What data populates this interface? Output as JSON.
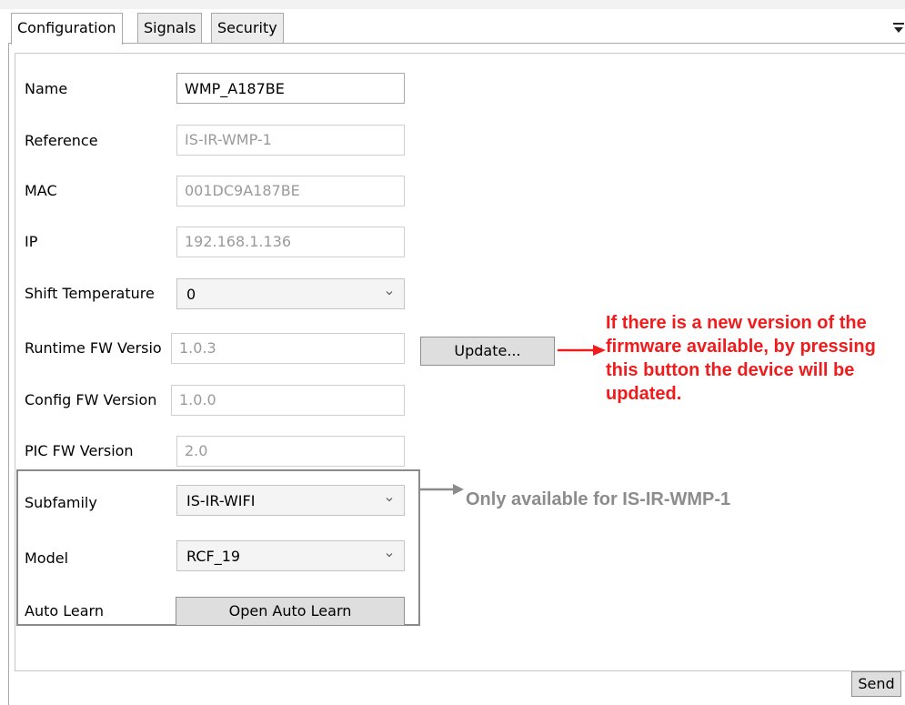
{
  "tabs": [
    {
      "label": "Configuration",
      "active": true
    },
    {
      "label": "Signals",
      "active": false
    },
    {
      "label": "Security",
      "active": false
    }
  ],
  "form": {
    "name": {
      "label": "Name",
      "value": "WMP_A187BE"
    },
    "reference": {
      "label": "Reference",
      "value": "IS-IR-WMP-1"
    },
    "mac": {
      "label": "MAC",
      "value": "001DC9A187BE"
    },
    "ip": {
      "label": "IP",
      "value": "192.168.1.136"
    },
    "shift_temperature": {
      "label": "Shift Temperature",
      "value": "0"
    },
    "runtime_fw": {
      "label": "Runtime FW Versio",
      "value": "1.0.3"
    },
    "config_fw": {
      "label": "Config FW Version",
      "value": "1.0.0"
    },
    "pic_fw": {
      "label": "PIC FW Version",
      "value": "2.0"
    },
    "subfamily": {
      "label": "Subfamily",
      "value": "IS-IR-WIFI"
    },
    "model": {
      "label": "Model",
      "value": "RCF_19"
    },
    "auto_learn": {
      "label": "Auto Learn",
      "button": "Open Auto Learn"
    }
  },
  "buttons": {
    "update": "Update...",
    "send": "Send"
  },
  "annotations": {
    "update_note": "If there is a new version of the firmware available, by pressing this button the device will be updated.",
    "group_note": "Only available for IS-IR-WMP-1"
  },
  "colors": {
    "annotation_red": "#ee1c1c",
    "annotation_grey": "#8c8c8c"
  }
}
